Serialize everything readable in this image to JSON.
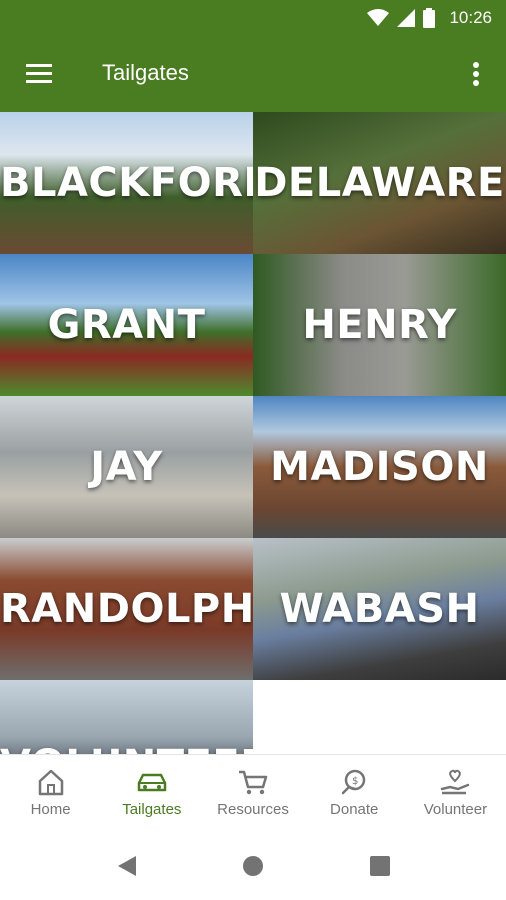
{
  "status_bar": {
    "time": "10:26"
  },
  "app_bar": {
    "title": "Tailgates"
  },
  "tiles": [
    {
      "label": "BLACKFORD"
    },
    {
      "label": "DELAWARE"
    },
    {
      "label": "GRANT"
    },
    {
      "label": "HENRY"
    },
    {
      "label": "JAY"
    },
    {
      "label": "MADISON"
    },
    {
      "label": "RANDOLPH"
    },
    {
      "label": "WABASH"
    },
    {
      "label": "VOLUNTEER"
    }
  ],
  "bottom_nav": {
    "items": [
      {
        "label": "Home",
        "icon": "home-icon"
      },
      {
        "label": "Tailgates",
        "icon": "car-icon"
      },
      {
        "label": "Resources",
        "icon": "cart-icon"
      },
      {
        "label": "Donate",
        "icon": "donate-icon"
      },
      {
        "label": "Volunteer",
        "icon": "volunteer-heart-icon"
      }
    ],
    "active": "Tailgates"
  },
  "colors": {
    "primary": "#4a7c22",
    "inactive": "#757575"
  }
}
